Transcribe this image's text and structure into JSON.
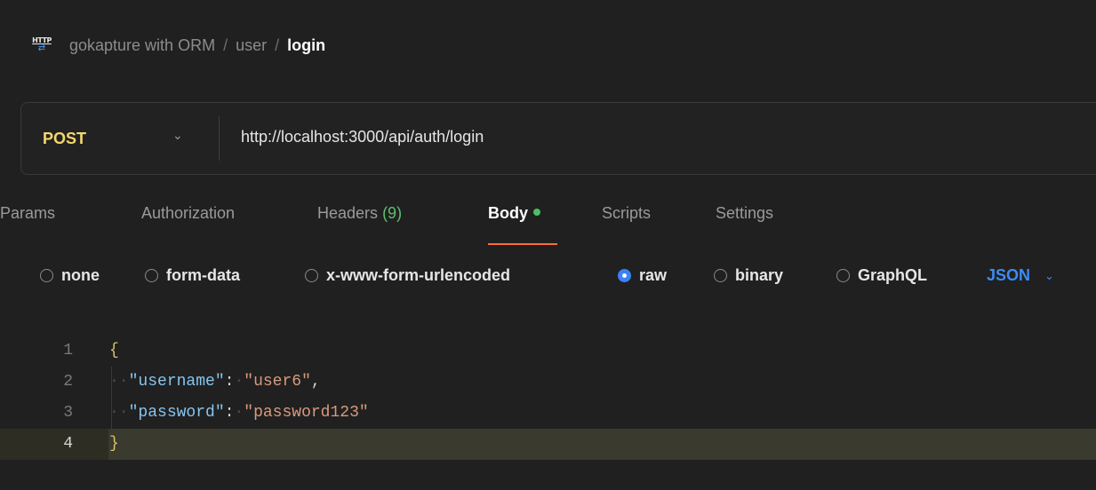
{
  "breadcrumb": {
    "collection": "gokapture with ORM",
    "separator": "/",
    "folder": "user",
    "request": "login"
  },
  "request": {
    "method": "POST",
    "url": "http://localhost:3000/api/auth/login"
  },
  "tabs": {
    "params": "Params",
    "authorization": "Authorization",
    "headers_label": "Headers",
    "headers_count": "(9)",
    "body": "Body",
    "scripts": "Scripts",
    "settings": "Settings"
  },
  "body_types": {
    "none": "none",
    "form_data": "form-data",
    "urlencoded": "x-www-form-urlencoded",
    "raw": "raw",
    "binary": "binary",
    "graphql": "GraphQL",
    "language": "JSON",
    "selected": "raw"
  },
  "editor": {
    "lines": [
      "1",
      "2",
      "3",
      "4"
    ],
    "open_brace": "{",
    "close_brace": "}",
    "key1": "\"username\"",
    "val1": "\"user6\"",
    "key2": "\"password\"",
    "val2": "\"password123\"",
    "colon": ":",
    "comma": ","
  },
  "colors": {
    "accent_tab": "#ff6c37",
    "method_post": "#f5d76e",
    "link_blue": "#3b8cf5",
    "dot_green": "#4cbf64"
  }
}
